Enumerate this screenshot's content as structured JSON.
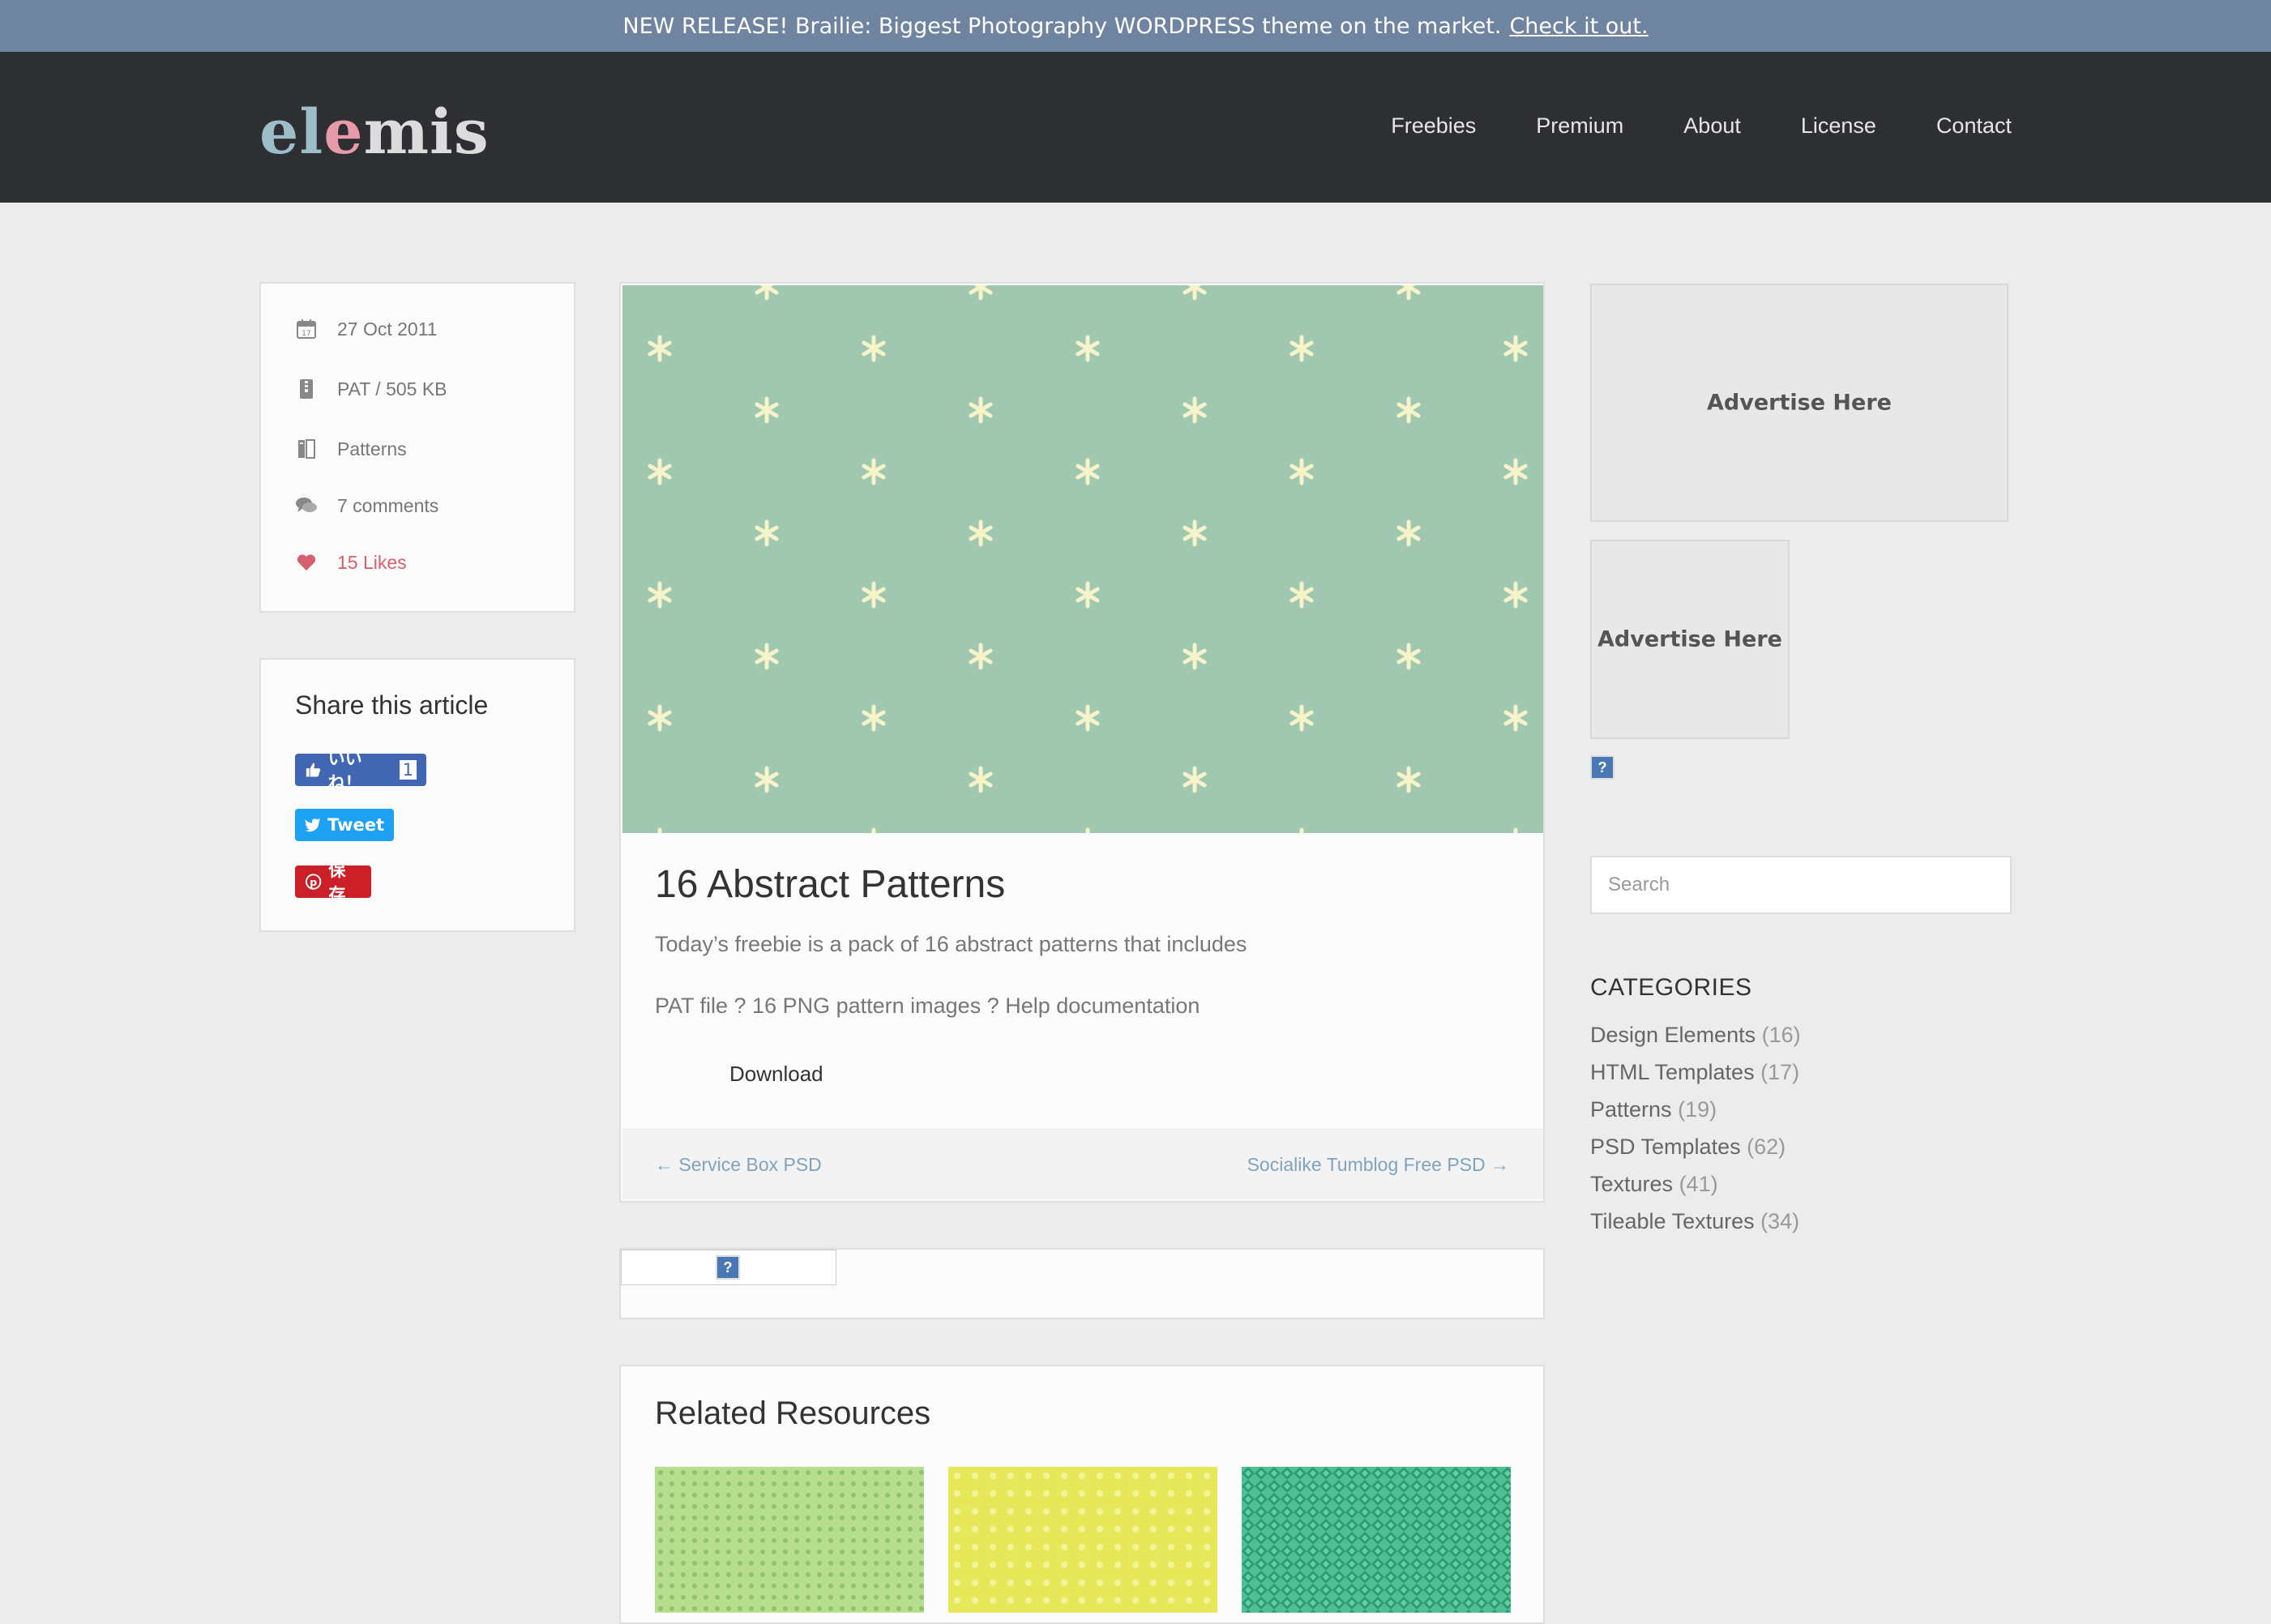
{
  "announcement": {
    "text": "NEW RELEASE! Brailie: Biggest Photography WORDPRESS theme on the market.",
    "link": "Check it out."
  },
  "logo": {
    "part1": "el",
    "part2": "e",
    "part3": "mis"
  },
  "nav": {
    "items": [
      "Freebies",
      "Premium",
      "About",
      "License",
      "Contact"
    ]
  },
  "meta": {
    "date": "27 Oct 2011",
    "file": "PAT / 505 KB",
    "category": "Patterns",
    "comments": "7 comments",
    "likes": "15 Likes"
  },
  "share": {
    "title": "Share this article",
    "facebook_label": "いいね！",
    "facebook_count": "1",
    "tweet_label": "Tweet",
    "pin_label": "保存"
  },
  "article": {
    "title": "16 Abstract Patterns",
    "intro": "Today’s freebie is a pack of 16 abstract patterns that includes",
    "includes": "PAT file ? 16 PNG pattern images ? Help documentation",
    "download": "Download",
    "prev": "← Service Box PSD",
    "next": "Socialike Tumblog Free PSD →"
  },
  "related": {
    "title": "Related Resources"
  },
  "sidebar": {
    "ad1": "Advertise Here",
    "ad2": "Advertise Here",
    "search_placeholder": "Search",
    "categories_title": "CATEGORIES",
    "categories": [
      {
        "name": "Design Elements",
        "count": "(16)"
      },
      {
        "name": "HTML Templates",
        "count": "(17)"
      },
      {
        "name": "Patterns",
        "count": "(19)"
      },
      {
        "name": "PSD Templates",
        "count": "(62)"
      },
      {
        "name": "Textures",
        "count": "(41)"
      },
      {
        "name": "Tileable Textures",
        "count": "(34)"
      }
    ]
  },
  "colors": {
    "topbar": "#6f84a1",
    "header": "#2e2f32",
    "pattern_bg": "#a0c8b0",
    "pattern_star": "#f6f3c8",
    "likes": "#d6606d",
    "link": "#7fa3bf"
  }
}
